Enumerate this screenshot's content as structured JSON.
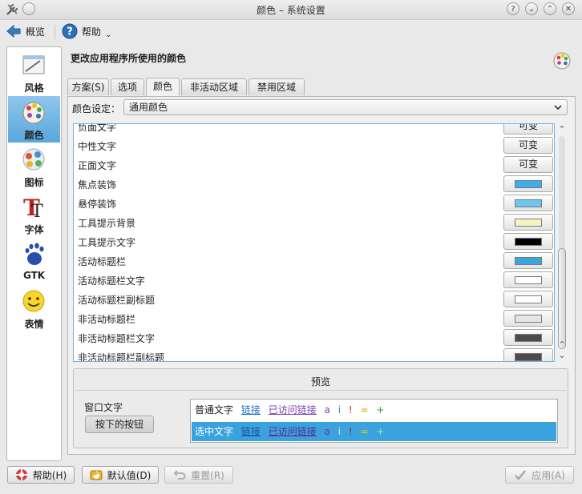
{
  "window": {
    "title": "颜色 – 系统设置"
  },
  "toolbar": {
    "overview_label": "概览",
    "help_label": "帮助"
  },
  "sidebar": {
    "items": [
      {
        "label": "风格",
        "active": false
      },
      {
        "label": "颜色",
        "active": true
      },
      {
        "label": "图标",
        "active": false
      },
      {
        "label": "字体",
        "active": false
      },
      {
        "label": "GTK",
        "active": false
      },
      {
        "label": "表情",
        "active": false
      }
    ]
  },
  "page": {
    "heading": "更改应用程序所使用的颜色"
  },
  "tabs": [
    "方案(S)",
    "选项",
    "颜色",
    "非活动区域",
    "禁用区域"
  ],
  "active_tab": "颜色",
  "color_set": {
    "label": "颜色设定：",
    "value": "通用颜色"
  },
  "color_rows": [
    {
      "name": "负面文字",
      "kind": "text",
      "button_label": "可变"
    },
    {
      "name": "中性文字",
      "kind": "text",
      "button_label": "可变"
    },
    {
      "name": "正面文字",
      "kind": "text",
      "button_label": "可变"
    },
    {
      "name": "焦点装饰",
      "kind": "color",
      "color": "#3daee9"
    },
    {
      "name": "悬停装饰",
      "kind": "color",
      "color": "#6dc6f1"
    },
    {
      "name": "工具提示背景",
      "kind": "color",
      "color": "#f8f4c0"
    },
    {
      "name": "工具提示文字",
      "kind": "color",
      "color": "#000000"
    },
    {
      "name": "活动标题栏",
      "kind": "color",
      "color": "#3ba6de"
    },
    {
      "name": "活动标题栏文字",
      "kind": "color",
      "color": "#ffffff"
    },
    {
      "name": "活动标题栏副标题",
      "kind": "color",
      "color": "#ffffff"
    },
    {
      "name": "非活动标题栏",
      "kind": "color",
      "color": "#e6e6e6"
    },
    {
      "name": "非活动标题栏文字",
      "kind": "color",
      "color": "#4d4a47"
    },
    {
      "name": "非活动标题栏副标题",
      "kind": "color",
      "color": "#4d4a47"
    }
  ],
  "preview": {
    "title": "预览",
    "window_text": "窗口文字",
    "pressed_button": "按下的按钮",
    "normal_line": {
      "text": "普通文字",
      "link": "链接",
      "visited": "已访问链接",
      "a": "a",
      "i": "i",
      "bang": "!",
      "eq": "=",
      "plus": "+"
    },
    "selected_line": {
      "text": "选中文字",
      "link": "链接",
      "visited": "已访问链接",
      "a": "a",
      "i": "i",
      "bang": "!",
      "eq": "=",
      "plus": "+"
    }
  },
  "buttons": {
    "help": "帮助(H)",
    "defaults": "默认值(D)",
    "reset": "重置(R)",
    "apply": "应用(A)"
  },
  "colors": {
    "accent": "#3aa3dd",
    "selection": "#3aa3dd",
    "link": "#1e6fc7",
    "visited": "#7b3fb0"
  }
}
